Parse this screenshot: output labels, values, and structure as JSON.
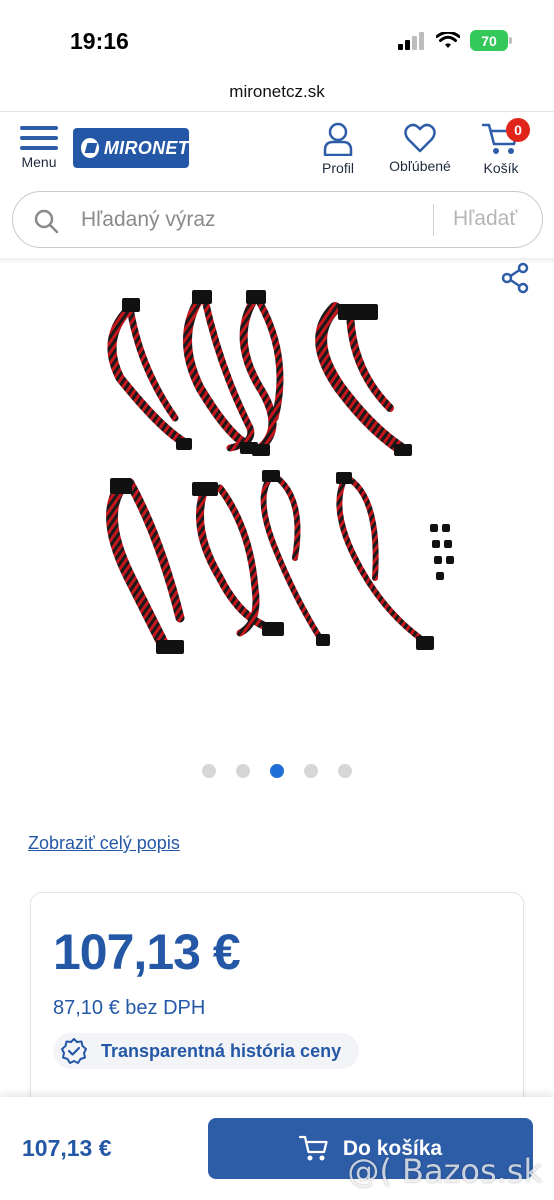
{
  "status_bar": {
    "time": "19:16",
    "battery": "70"
  },
  "browser": {
    "url": "mironetcz.sk"
  },
  "header": {
    "menu_label": "Menu",
    "logo_text": "MIRONET",
    "profile_label": "Profil",
    "favorites_label": "Obľúbené",
    "cart_label": "Košík",
    "cart_count": "0"
  },
  "search": {
    "placeholder": "Hľadaný výraz",
    "button_label": "Hľadať"
  },
  "gallery": {
    "image_count": 5,
    "active_index": 2
  },
  "product": {
    "description_link": "Zobraziť celý popis",
    "price": "107,13 €",
    "price_without_vat": "87,10 € bez DPH",
    "price_history_label": "Transparentná história ceny"
  },
  "bottom_bar": {
    "price": "107,13 €",
    "add_to_cart_label": "Do košíka"
  },
  "watermark": "@( Bazos.sk",
  "colors": {
    "brand_blue": "#2458a6",
    "badge_red": "#e1251b",
    "active_dot": "#1f6fd8",
    "battery_green": "#34c759"
  }
}
